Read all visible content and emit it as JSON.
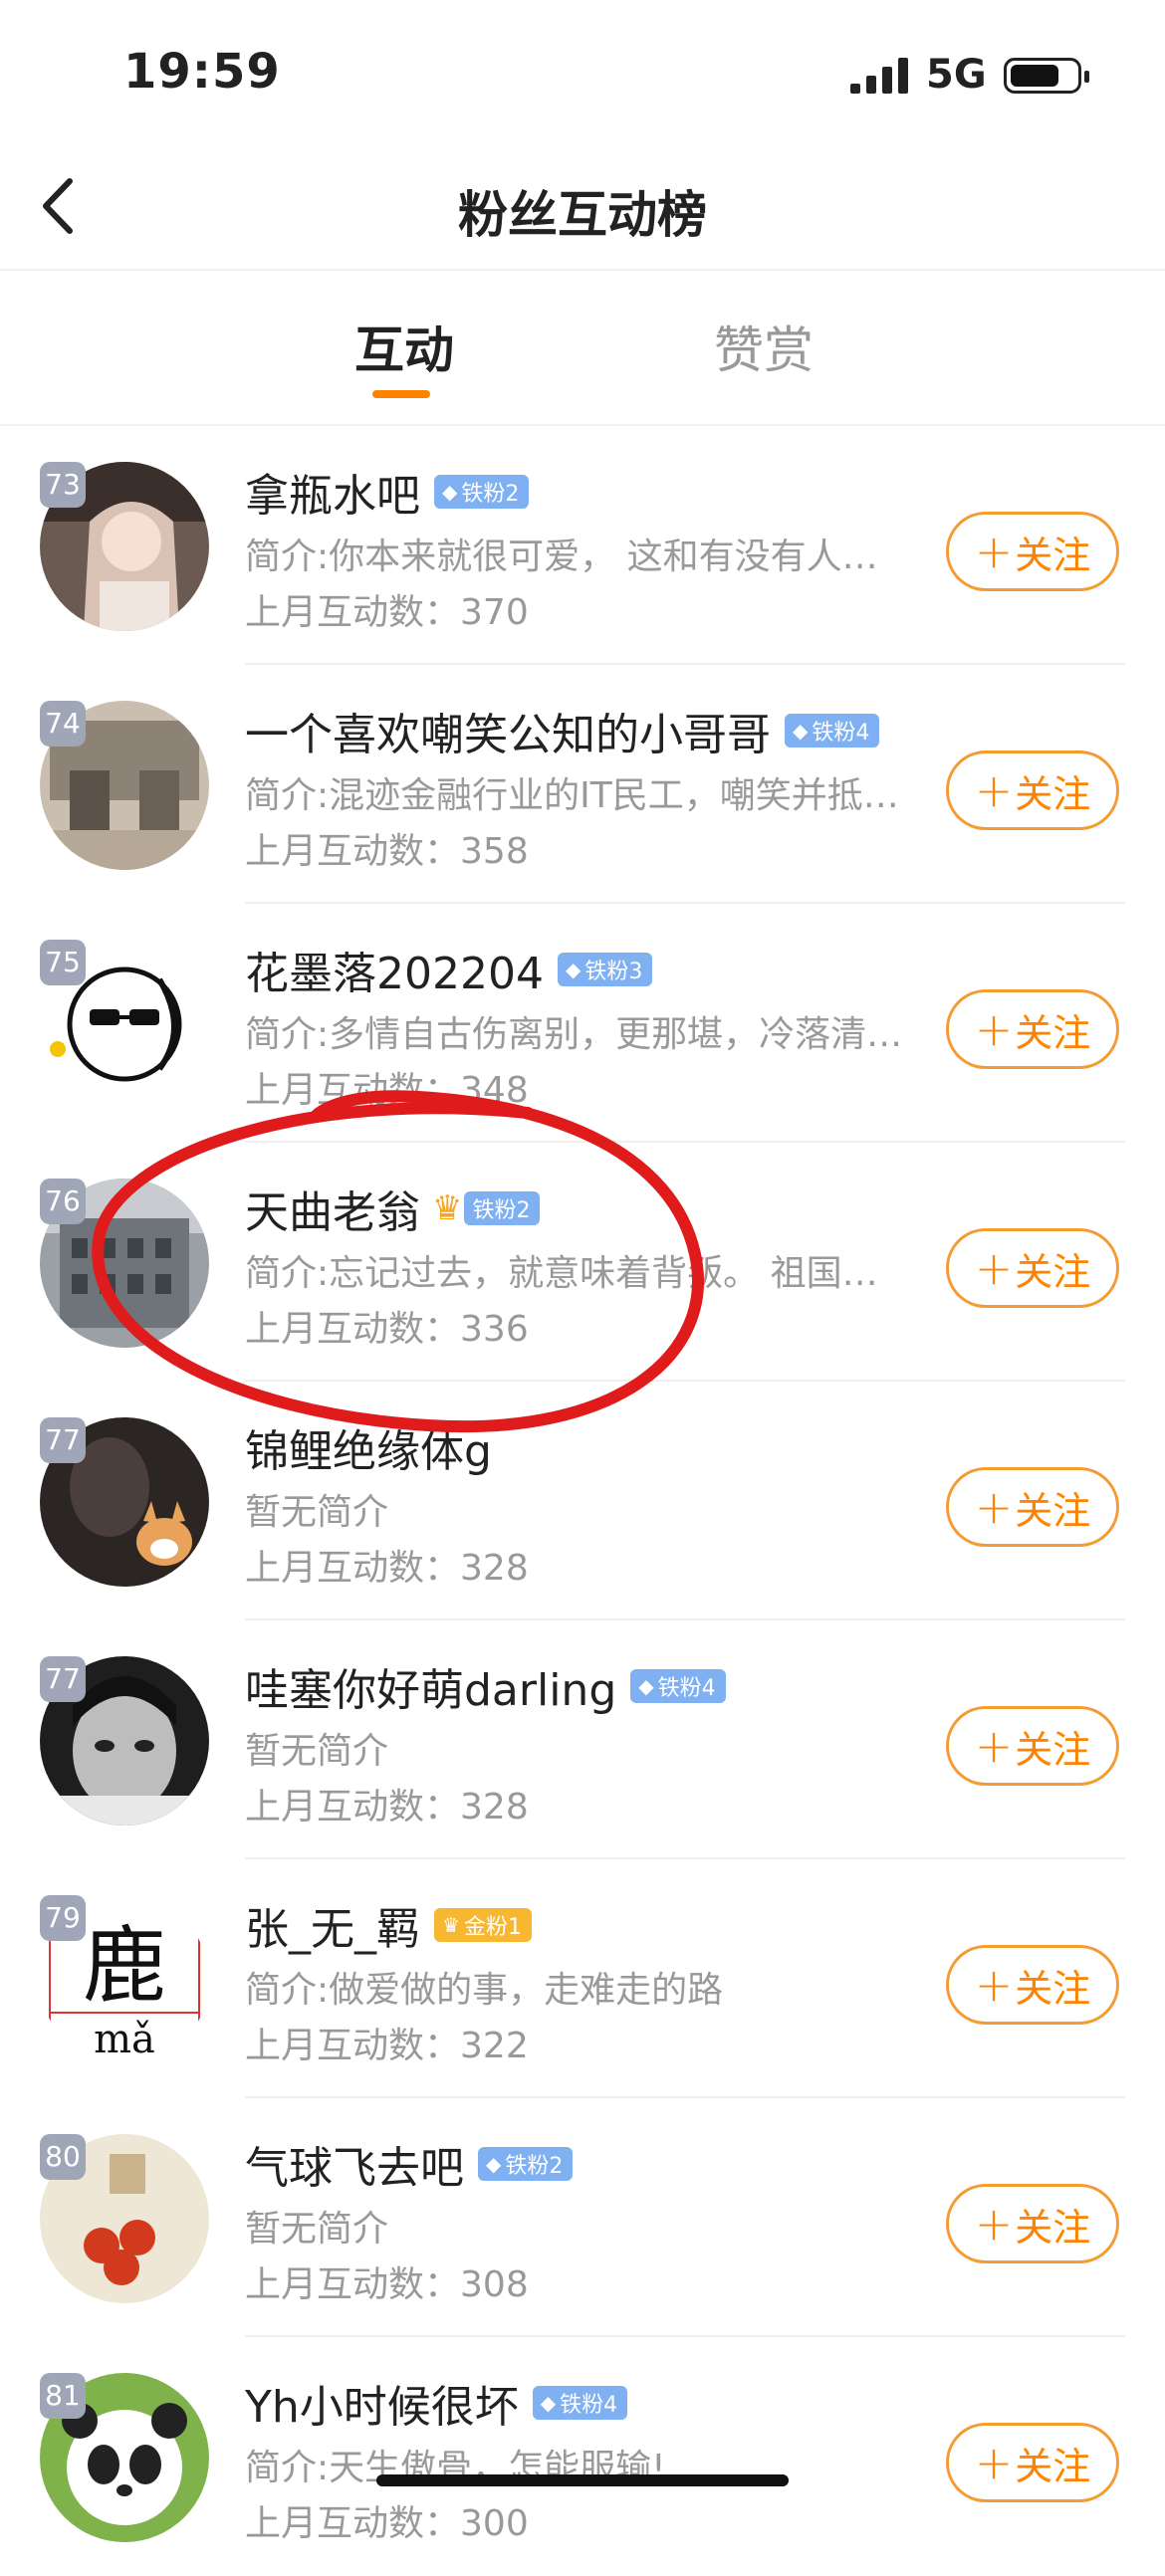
{
  "status_bar": {
    "time": "19:59",
    "network": "5G"
  },
  "nav": {
    "title": "粉丝互动榜"
  },
  "tabs": [
    {
      "label": "互动",
      "active": true
    },
    {
      "label": "赞赏",
      "active": false
    }
  ],
  "colors": {
    "accent": "#ff8200",
    "iron_badge": "#7fb0f2",
    "gold_badge": "#f7b731",
    "annotation_circle": "#e01b1b"
  },
  "count_prefix": "上月互动数：",
  "follow_label": "关注",
  "fans": [
    {
      "rank": "73",
      "name": "拿瓶水吧",
      "badge": "铁粉2",
      "badge_type": "iron",
      "bio": "简介:你本来就很可爱， 这和有没有人爱…",
      "count": "370"
    },
    {
      "rank": "74",
      "name": "一个喜欢嘲笑公知的小哥哥",
      "badge": "铁粉4",
      "badge_type": "iron",
      "bio": "简介:混迹金融行业的IT民工，嘲笑并抵…",
      "count": "358"
    },
    {
      "rank": "75",
      "name": "花墨落202204",
      "badge": "铁粉3",
      "badge_type": "iron",
      "bio": "简介:多情自古伤离别，更那堪，冷落清…",
      "count": "348"
    },
    {
      "rank": "76",
      "name": "天曲老翁",
      "badge": "铁粉2",
      "badge_type": "iron",
      "crown": true,
      "bio": "简介:忘记过去，就意味着背叛。 祖国统…",
      "count": "336"
    },
    {
      "rank": "77",
      "name": "锦鲤绝缘体g",
      "badge": "",
      "badge_type": "",
      "bio": "暂无简介",
      "count": "328"
    },
    {
      "rank": "77",
      "name": "哇塞你好萌darling",
      "badge": "铁粉4",
      "badge_type": "iron",
      "bio": "暂无简介",
      "count": "328"
    },
    {
      "rank": "79",
      "name": "张_无_羁",
      "badge": "金粉1",
      "badge_type": "gold",
      "bio": "简介:做爱做的事，走难走的路",
      "count": "322"
    },
    {
      "rank": "80",
      "name": "气球飞去吧",
      "badge": "铁粉2",
      "badge_type": "iron",
      "bio": "暂无简介",
      "count": "308"
    },
    {
      "rank": "81",
      "name": "Yh小时候很坏",
      "badge": "铁粉4",
      "badge_type": "iron",
      "bio": "简介:天生傲骨，怎能服输!",
      "count": "300"
    }
  ],
  "avatar_texts": {
    "deer_char": "鹿",
    "deer_pinyin": "mǎ"
  }
}
